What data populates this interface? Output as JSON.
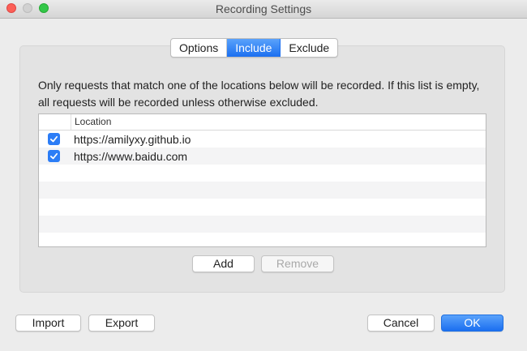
{
  "window": {
    "title": "Recording Settings"
  },
  "tabs": [
    {
      "label": "Options",
      "active": false
    },
    {
      "label": "Include",
      "active": true
    },
    {
      "label": "Exclude",
      "active": false
    }
  ],
  "description": "Only requests that match one of the locations below will be recorded. If this list is empty, all requests will be recorded unless otherwise excluded.",
  "table": {
    "column_header": "Location",
    "rows": [
      {
        "checked": true,
        "location": "https://amilyxy.github.io"
      },
      {
        "checked": true,
        "location": "https://www.baidu.com"
      }
    ]
  },
  "list_buttons": {
    "add": "Add",
    "remove": "Remove"
  },
  "footer": {
    "import": "Import",
    "export": "Export",
    "cancel": "Cancel",
    "ok": "OK"
  },
  "colors": {
    "accent": "#1b6ff0",
    "checkbox": "#2c7df6"
  }
}
